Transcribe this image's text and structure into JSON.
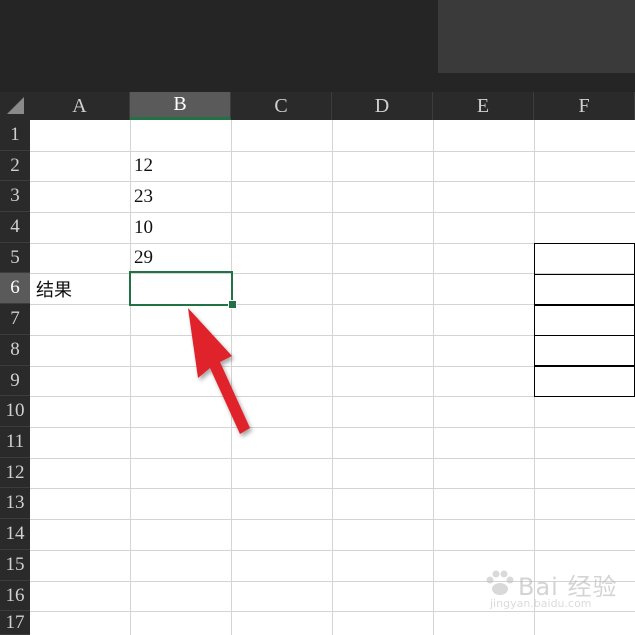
{
  "spreadsheet": {
    "columns": [
      "A",
      "B",
      "C",
      "D",
      "E",
      "F"
    ],
    "selected_column": "B",
    "rows": [
      "1",
      "2",
      "3",
      "4",
      "5",
      "6",
      "7",
      "8",
      "9",
      "10",
      "11",
      "12",
      "13",
      "14",
      "15",
      "16",
      "17"
    ],
    "selected_row": "6",
    "cells": {
      "B2": "12",
      "B3": "23",
      "B4": "10",
      "B5": "29",
      "A6": "结果"
    },
    "active_cell": "B6",
    "accent_color": "#217346"
  },
  "annotation": {
    "arrow_color": "#e0202a",
    "arrow_icon": "red-arrow-pointer-icon"
  },
  "watermark": {
    "brand": "Bai 经验",
    "url": "jingyan.baidu.com"
  }
}
